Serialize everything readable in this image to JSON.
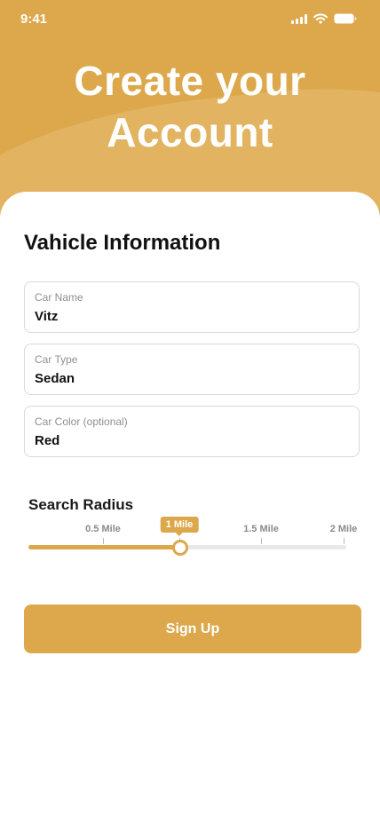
{
  "status_bar": {
    "time": "9:41"
  },
  "header": {
    "title_line1": "Create your",
    "title_line2": "Account"
  },
  "form": {
    "section_title": "Vahicle Information",
    "fields": [
      {
        "label": "Car Name",
        "value": "Vitz"
      },
      {
        "label": "Car Type",
        "value": "Sedan"
      },
      {
        "label": "Car Color (optional)",
        "value": "Red"
      }
    ]
  },
  "search_radius": {
    "title": "Search Radius",
    "ticks": [
      "0.5 Mile",
      "1 Mile",
      "1.5 Mile",
      "2 Mile"
    ],
    "selected_label": "1 Mile",
    "selected_value_miles": 1,
    "min_miles": 0,
    "max_miles": 2
  },
  "actions": {
    "signup_label": "Sign Up"
  },
  "colors": {
    "accent": "#dca84b",
    "text": "#111111",
    "muted": "#8f8f8f"
  }
}
